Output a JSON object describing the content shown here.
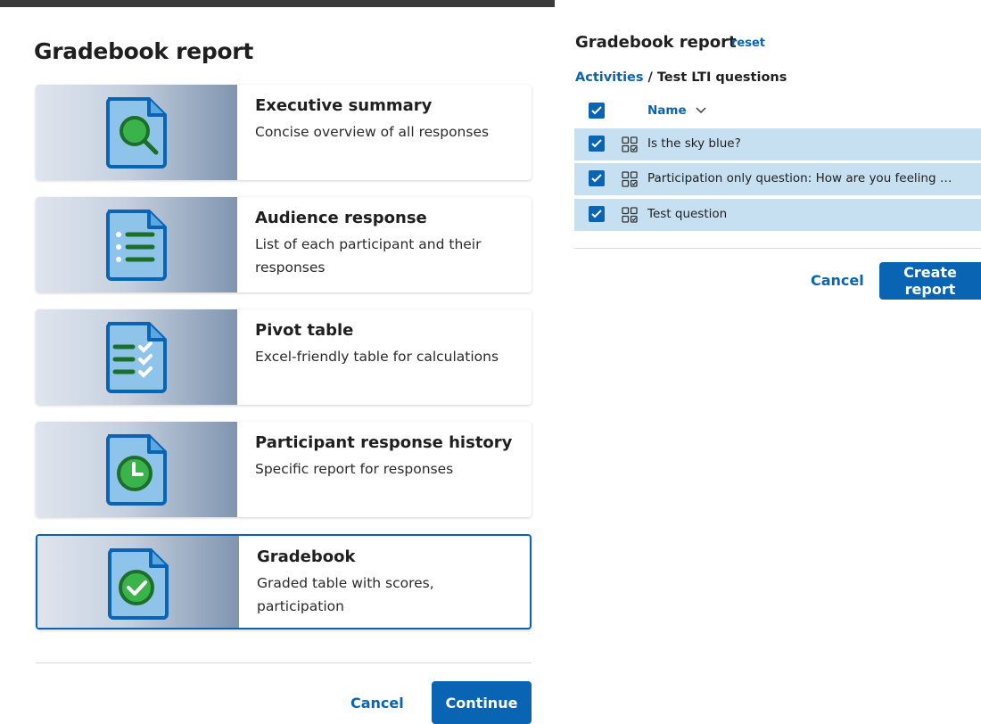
{
  "left": {
    "title": "Gradebook report",
    "cards": [
      {
        "title": "Executive summary",
        "desc": "Concise overview of all responses",
        "icon": "magnifier-document-icon"
      },
      {
        "title": "Audience response",
        "desc": "List of each participant and their responses",
        "icon": "list-document-icon"
      },
      {
        "title": "Pivot table",
        "desc": "Excel-friendly table for calculations",
        "icon": "checklist-document-icon"
      },
      {
        "title": "Participant response history",
        "desc": "Specific report for responses",
        "icon": "clock-document-icon"
      },
      {
        "title": "Gradebook",
        "desc": "Graded table with scores, participation",
        "icon": "check-document-icon",
        "selected": true
      }
    ],
    "cancel_label": "Cancel",
    "continue_label": "Continue"
  },
  "right": {
    "title": "Gradebook report",
    "reset_label": "reset",
    "breadcrumb": {
      "link": "Activities",
      "separator": "/",
      "current": "Test LTI questions"
    },
    "table": {
      "name_header": "Name",
      "rows": [
        {
          "text": "Is the sky blue?",
          "checked": true
        },
        {
          "text": "Participation only question: How are you feeling …",
          "checked": true
        },
        {
          "text": "Test question",
          "checked": true
        }
      ]
    },
    "cancel_label": "Cancel",
    "create_label": "Create report"
  },
  "colors": {
    "accent": "#0a64b4",
    "row_selected": "#c6e0f2",
    "icon_green": "#2e9a3e",
    "icon_blue": "#8fc4ea"
  }
}
